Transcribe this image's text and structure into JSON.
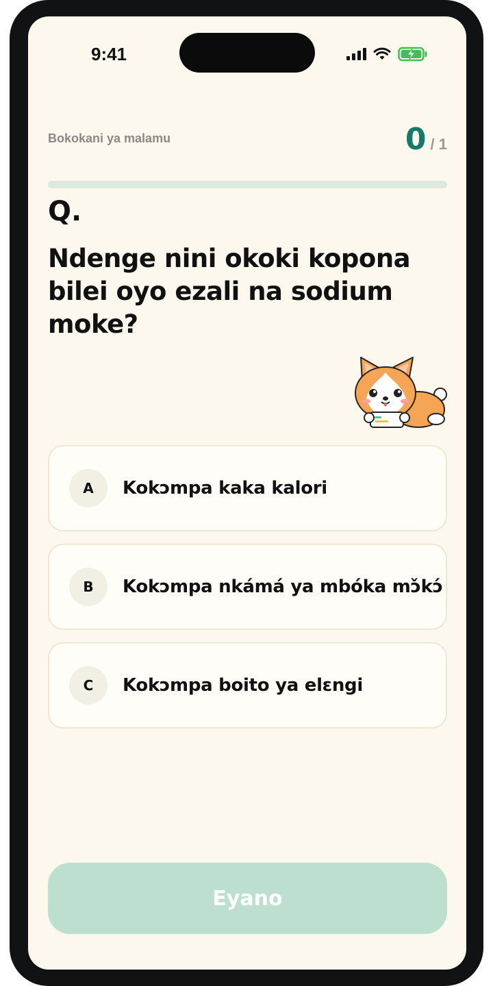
{
  "status_bar": {
    "time": "9:41"
  },
  "header": {
    "quiz_title": "Bokokani ya malamu",
    "score": "0",
    "score_total": "/ 1",
    "progress_fraction": 0
  },
  "question": {
    "label": "Q.",
    "text": "Ndenge nini okoki kopona bilei oyo ezali na sodium moke?"
  },
  "options": [
    {
      "letter": "A",
      "text": "Kokɔmpa kaka kalori"
    },
    {
      "letter": "B",
      "text": "Kokɔmpa nkámá ya mbóka mɔ̌kɔ́"
    },
    {
      "letter": "C",
      "text": "Kokɔmpa boito ya elɛngi"
    }
  ],
  "submit": {
    "label": "Eyano",
    "color": "#bddfcf"
  },
  "colors": {
    "accent": "#137b6a",
    "background": "#fdf8ee"
  },
  "icons": [
    "signal-icon",
    "wifi-icon",
    "battery-charging-icon",
    "corgi-mascot"
  ]
}
